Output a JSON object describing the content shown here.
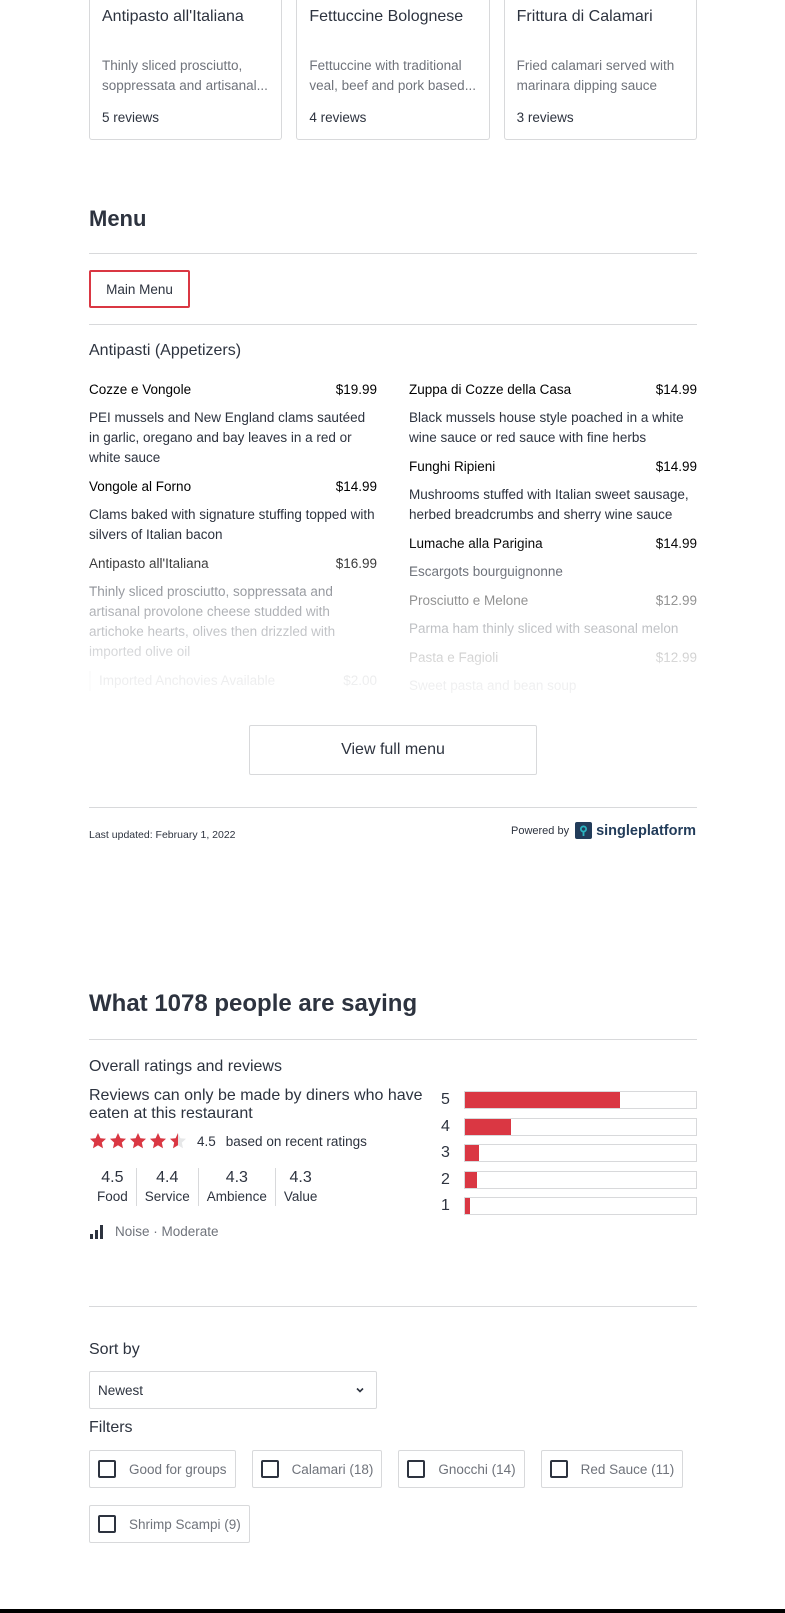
{
  "popular_dishes": [
    {
      "name": "Antipasto all'Italiana",
      "description": "Thinly sliced prosciutto, soppressata and artisanal...",
      "reviews": "5 reviews"
    },
    {
      "name": "Fettuccine Bolognese",
      "description": "Fettuccine with traditional veal, beef and pork based...",
      "reviews": "4 reviews"
    },
    {
      "name": "Frittura di Calamari",
      "description": "Fried calamari served with marinara dipping sauce",
      "reviews": "3 reviews"
    }
  ],
  "menu": {
    "heading": "Menu",
    "tab": "Main Menu",
    "section_title": "Antipasti (Appetizers)",
    "left_items": [
      {
        "name": "Cozze e Vongole",
        "price": "$19.99",
        "description": "PEI mussels and New England clams sautéed in garlic, oregano and bay leaves in a red or white sauce"
      },
      {
        "name": "Vongole al Forno",
        "price": "$14.99",
        "description": "Clams baked with signature stuffing topped with silvers of Italian bacon"
      },
      {
        "name": "Antipasto all'Italiana",
        "price": "$16.99",
        "description": "Thinly sliced prosciutto, soppressata and artisanal provolone cheese studded with artichoke hearts, olives then drizzled with imported olive oil"
      }
    ],
    "left_addon": {
      "name": "Imported Anchovies Available",
      "price": "$2.00"
    },
    "right_items": [
      {
        "name": "Zuppa di Cozze della Casa",
        "price": "$14.99",
        "description": "Black mussels house style poached in a white wine sauce or red sauce with fine herbs"
      },
      {
        "name": "Funghi Ripieni",
        "price": "$14.99",
        "description": "Mushrooms stuffed with Italian sweet sausage, herbed breadcrumbs and sherry wine sauce"
      },
      {
        "name": "Lumache alla Parigina",
        "price": "$14.99",
        "description": "Escargots bourguignonne"
      },
      {
        "name": "Prosciutto e Melone",
        "price": "$12.99",
        "description": "Parma ham thinly sliced with seasonal melon"
      },
      {
        "name": "Pasta e Fagioli",
        "price": "$12.99",
        "description": "Sweet pasta and bean soup"
      }
    ],
    "view_full_menu": "View full menu",
    "last_updated": "Last updated: February 1, 2022",
    "powered_by": "Powered by",
    "powered_brand": "singleplatform"
  },
  "reviews": {
    "heading": "What 1078 people are saying",
    "overall_title": "Overall ratings and reviews",
    "note": "Reviews can only be made by diners who have eaten at this restaurant",
    "stars_value": 4.5,
    "average": "4.5",
    "based_on": "based on recent ratings",
    "subratings": [
      {
        "value": "4.5",
        "label": "Food"
      },
      {
        "value": "4.4",
        "label": "Service"
      },
      {
        "value": "4.3",
        "label": "Ambience"
      },
      {
        "value": "4.3",
        "label": "Value"
      }
    ],
    "noise_label": "Noise",
    "noise_value": "Moderate",
    "distribution": [
      {
        "label": "5",
        "fraction": 0.67
      },
      {
        "label": "4",
        "fraction": 0.2
      },
      {
        "label": "3",
        "fraction": 0.06
      },
      {
        "label": "2",
        "fraction": 0.05
      },
      {
        "label": "1",
        "fraction": 0.02
      }
    ],
    "accent_color": "#da3743"
  },
  "sort": {
    "label": "Sort by",
    "selected": "Newest"
  },
  "filters": {
    "label": "Filters",
    "chips": [
      "Good for groups",
      "Calamari (18)",
      "Gnocchi (14)",
      "Red Sauce (11)",
      "Shrimp Scampi (9)"
    ]
  }
}
